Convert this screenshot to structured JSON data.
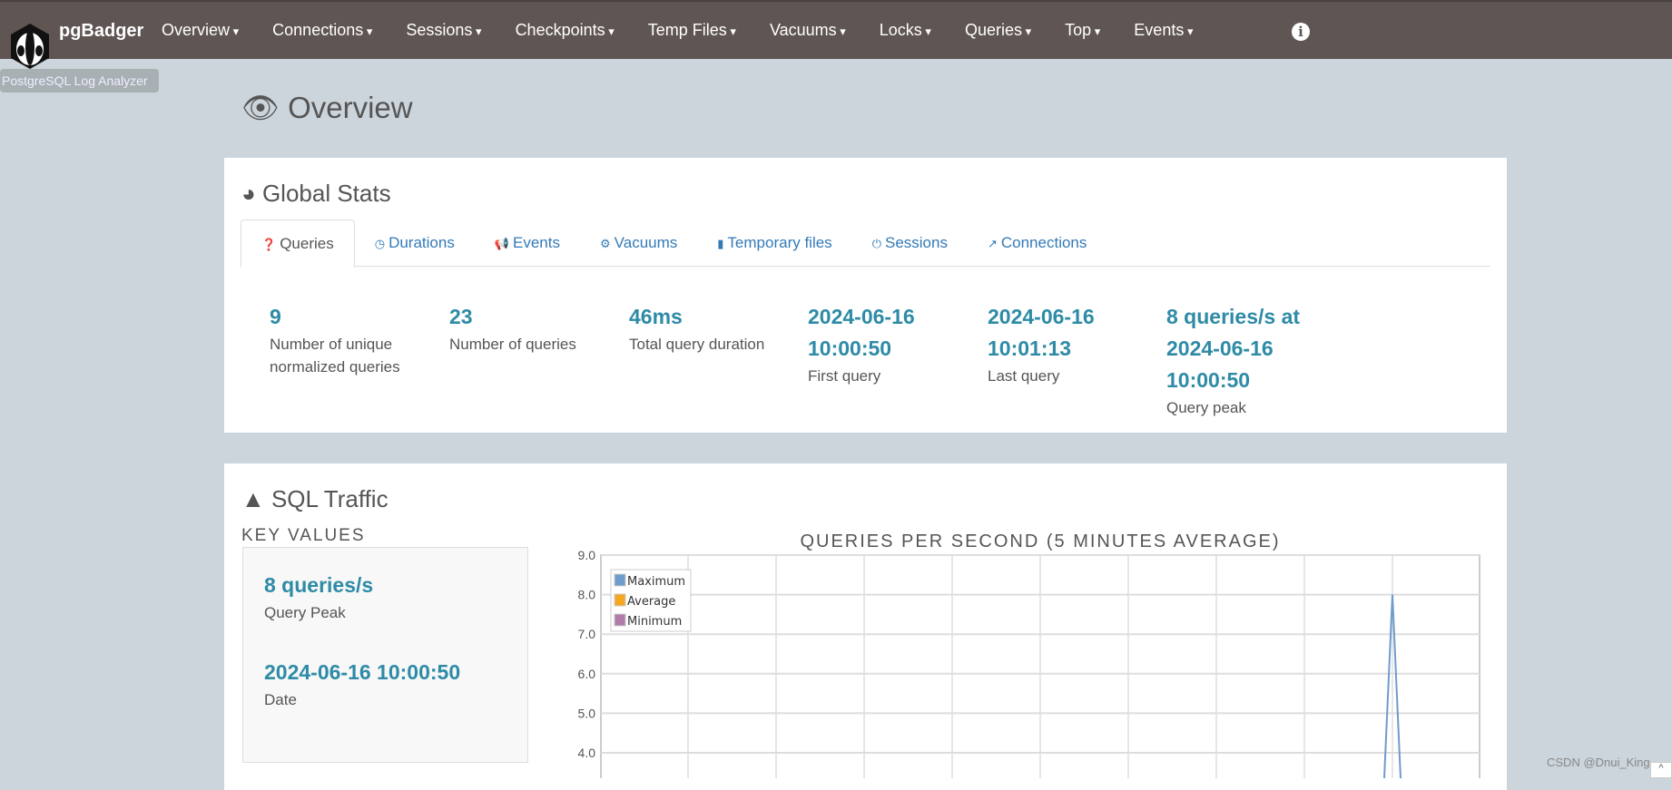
{
  "nav": {
    "brand": "pgBadger",
    "tooltip": "PostgreSQL Log Analyzer",
    "items": [
      "Overview",
      "Connections",
      "Sessions",
      "Checkpoints",
      "Temp Files",
      "Vacuums",
      "Locks",
      "Queries",
      "Top",
      "Events"
    ],
    "info_icon": "info-icon"
  },
  "page": {
    "title": "Overview"
  },
  "global_stats": {
    "title": "Global Stats",
    "tabs": [
      {
        "label": "Queries",
        "icon": "question-circle-icon"
      },
      {
        "label": "Durations",
        "icon": "clock-icon"
      },
      {
        "label": "Events",
        "icon": "bullhorn-icon"
      },
      {
        "label": "Vacuums",
        "icon": "cogs-icon"
      },
      {
        "label": "Temporary files",
        "icon": "file-icon"
      },
      {
        "label": "Sessions",
        "icon": "power-icon"
      },
      {
        "label": "Connections",
        "icon": "external-link-icon"
      }
    ],
    "stats": [
      {
        "value": "9",
        "label": "Number of unique normalized queries"
      },
      {
        "value": "23",
        "label": "Number of queries"
      },
      {
        "value": "46ms",
        "label": "Total query duration"
      },
      {
        "value": "2024-06-16 10:00:50",
        "label": "First query"
      },
      {
        "value": "2024-06-16 10:01:13",
        "label": "Last query"
      },
      {
        "value": "8 queries/s at 2024-06-16 10:00:50",
        "label": "Query peak"
      }
    ]
  },
  "sql_traffic": {
    "title": "SQL Traffic",
    "key_values_title": "KEY VALUES",
    "key_values": [
      {
        "value": "8 queries/s",
        "label": "Query Peak"
      },
      {
        "value": "2024-06-16 10:00:50",
        "label": "Date"
      }
    ]
  },
  "chart_data": {
    "type": "line",
    "title": "QUERIES PER SECOND (5 MINUTES AVERAGE)",
    "yticks": [
      "9.0",
      "8.0",
      "7.0",
      "6.0",
      "5.0",
      "4.0"
    ],
    "ylim_visible": [
      4,
      9
    ],
    "series": [
      {
        "name": "Maximum",
        "color": "#6e9ccc",
        "peak": 8
      },
      {
        "name": "Average",
        "color": "#f5a623"
      },
      {
        "name": "Minimum",
        "color": "#b07ca8"
      }
    ],
    "legend": "top-left",
    "grid": true
  },
  "watermark": "CSDN @Dnui_King"
}
